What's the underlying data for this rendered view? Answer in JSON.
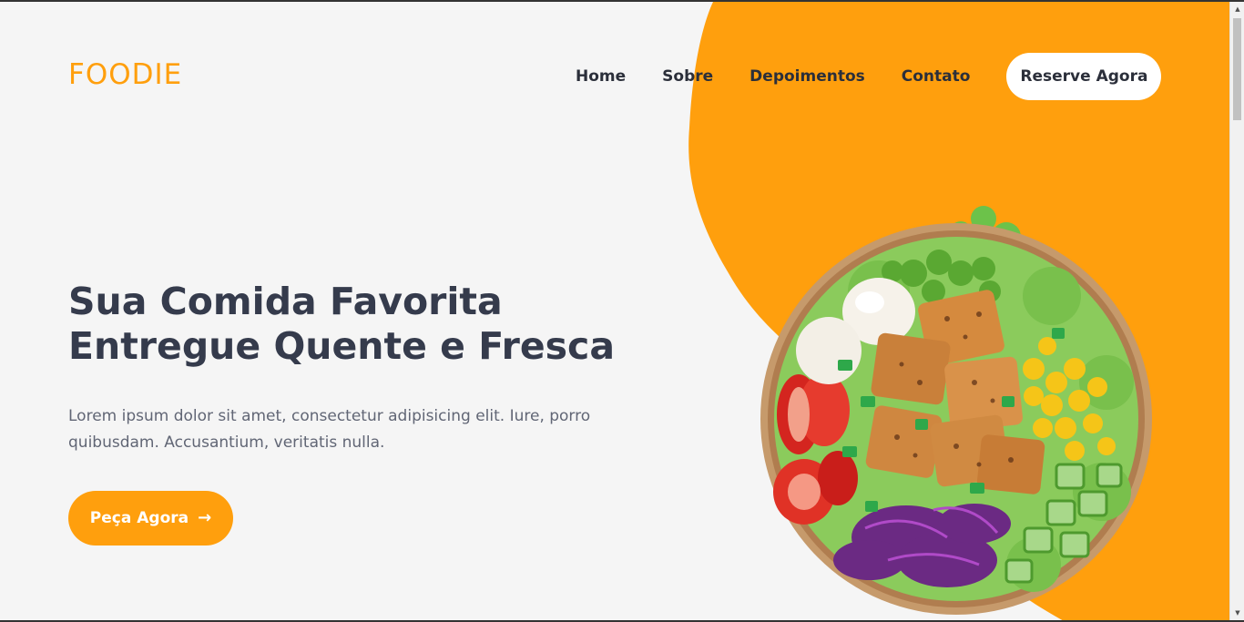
{
  "colors": {
    "accent": "#ff9f0d",
    "background": "#f5f5f5",
    "text_dark": "#2b2f3a",
    "heading": "#353b4c",
    "body_text": "#616675",
    "white": "#ffffff"
  },
  "header": {
    "logo": "FOODIE",
    "nav": [
      {
        "label": "Home"
      },
      {
        "label": "Sobre"
      },
      {
        "label": "Depoimentos"
      },
      {
        "label": "Contato"
      }
    ],
    "cta_label": "Reserve Agora"
  },
  "hero": {
    "title_line1": "Sua Comida Favorita",
    "title_line2": "Entregue Quente e Fresca",
    "description": "Lorem ipsum dolor sit amet, consectetur adipisicing elit. Iure, porro quibusdam. Accusantium, veritatis nulla.",
    "button_label": "Peça Agora",
    "button_icon": "arrow-right-icon"
  },
  "image": {
    "subject": "salad-bowl-icon"
  }
}
